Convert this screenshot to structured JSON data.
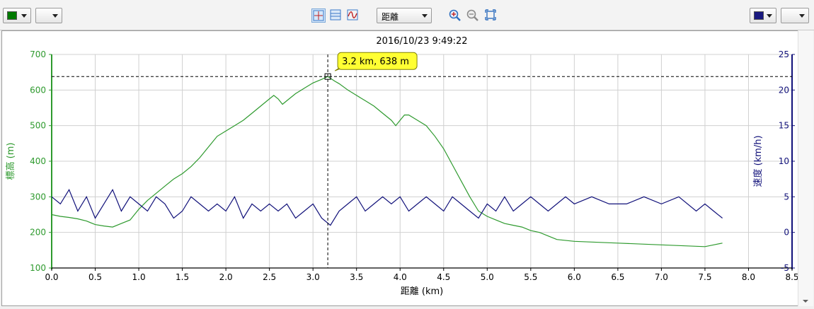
{
  "toolbar": {
    "left_color": "#007a00",
    "right_color": "#1a1a80",
    "mode_selected": "距離",
    "tools": [
      "crosshair-tool",
      "split-view-tool",
      "smooth-line-tool",
      "zoom-in-tool",
      "zoom-out-tool",
      "fit-view-tool"
    ]
  },
  "chart_data": {
    "type": "line",
    "title": "2016/10/23 9:49:22",
    "xlabel": "距離 (km)",
    "y_left_label": "標高 (m)",
    "y_right_label": "速度 (km/h)",
    "xlim": [
      0,
      8.5
    ],
    "y_left_lim": [
      100,
      700
    ],
    "y_right_lim": [
      -5,
      25
    ],
    "x_ticks": [
      "0.0",
      "0.5",
      "1.0",
      "1.5",
      "2.0",
      "2.5",
      "3.0",
      "3.5",
      "4.0",
      "4.5",
      "5.0",
      "5.5",
      "6.0",
      "6.5",
      "7.0",
      "7.5",
      "8.0",
      "8.5"
    ],
    "y_left_ticks": [
      "100",
      "200",
      "300",
      "400",
      "500",
      "600",
      "700"
    ],
    "y_right_ticks": [
      "-5",
      "0",
      "5",
      "10",
      "15",
      "20",
      "25"
    ],
    "grid": true,
    "elevation_color": "#2e9a2e",
    "speed_color": "#11117a",
    "cursor": {
      "x": 3.17,
      "y": 638,
      "label": "3.2 km, 638 m"
    },
    "series": [
      {
        "name": "標高",
        "axis": "left",
        "x": [
          0,
          0.1,
          0.2,
          0.3,
          0.4,
          0.5,
          0.6,
          0.7,
          0.8,
          0.9,
          1.0,
          1.1,
          1.2,
          1.3,
          1.4,
          1.5,
          1.6,
          1.7,
          1.8,
          1.9,
          2.0,
          2.1,
          2.2,
          2.3,
          2.4,
          2.5,
          2.55,
          2.6,
          2.65,
          2.7,
          2.8,
          2.9,
          3.0,
          3.1,
          3.17,
          3.25,
          3.3,
          3.4,
          3.5,
          3.6,
          3.7,
          3.8,
          3.9,
          3.95,
          4.0,
          4.05,
          4.1,
          4.2,
          4.3,
          4.4,
          4.5,
          4.6,
          4.7,
          4.8,
          4.9,
          5.0,
          5.1,
          5.2,
          5.3,
          5.4,
          5.5,
          5.6,
          5.7,
          5.8,
          6.0,
          6.5,
          7.0,
          7.5,
          7.6,
          7.7
        ],
        "values": [
          250,
          245,
          242,
          238,
          232,
          222,
          218,
          215,
          225,
          235,
          265,
          290,
          310,
          330,
          350,
          365,
          385,
          410,
          440,
          470,
          485,
          500,
          515,
          535,
          555,
          575,
          585,
          575,
          560,
          570,
          590,
          605,
          620,
          630,
          638,
          625,
          618,
          600,
          585,
          570,
          555,
          535,
          515,
          500,
          515,
          530,
          530,
          515,
          500,
          470,
          435,
          390,
          345,
          300,
          260,
          245,
          235,
          225,
          220,
          215,
          205,
          200,
          190,
          180,
          175,
          170,
          165,
          160,
          165,
          170
        ]
      },
      {
        "name": "速度",
        "axis": "right",
        "x": [
          0,
          0.1,
          0.2,
          0.3,
          0.4,
          0.5,
          0.6,
          0.7,
          0.8,
          0.9,
          1.0,
          1.1,
          1.2,
          1.3,
          1.4,
          1.5,
          1.6,
          1.7,
          1.8,
          1.9,
          2.0,
          2.1,
          2.2,
          2.3,
          2.4,
          2.5,
          2.6,
          2.7,
          2.8,
          2.9,
          3.0,
          3.1,
          3.2,
          3.3,
          3.4,
          3.5,
          3.6,
          3.7,
          3.8,
          3.9,
          4.0,
          4.1,
          4.2,
          4.3,
          4.4,
          4.5,
          4.6,
          4.7,
          4.8,
          4.9,
          5.0,
          5.1,
          5.2,
          5.3,
          5.4,
          5.5,
          5.6,
          5.7,
          5.8,
          5.9,
          6.0,
          6.2,
          6.4,
          6.6,
          6.8,
          7.0,
          7.2,
          7.4,
          7.5,
          7.6,
          7.7
        ],
        "values": [
          5,
          4,
          6,
          3,
          5,
          2,
          4,
          6,
          3,
          5,
          4,
          3,
          5,
          4,
          2,
          3,
          5,
          4,
          3,
          4,
          3,
          5,
          2,
          4,
          3,
          4,
          3,
          4,
          2,
          3,
          4,
          2,
          1,
          3,
          4,
          5,
          3,
          4,
          5,
          4,
          5,
          3,
          4,
          5,
          4,
          3,
          5,
          4,
          3,
          2,
          4,
          3,
          5,
          3,
          4,
          5,
          4,
          3,
          4,
          5,
          4,
          5,
          4,
          4,
          5,
          4,
          5,
          3,
          4,
          3,
          2
        ]
      }
    ]
  }
}
